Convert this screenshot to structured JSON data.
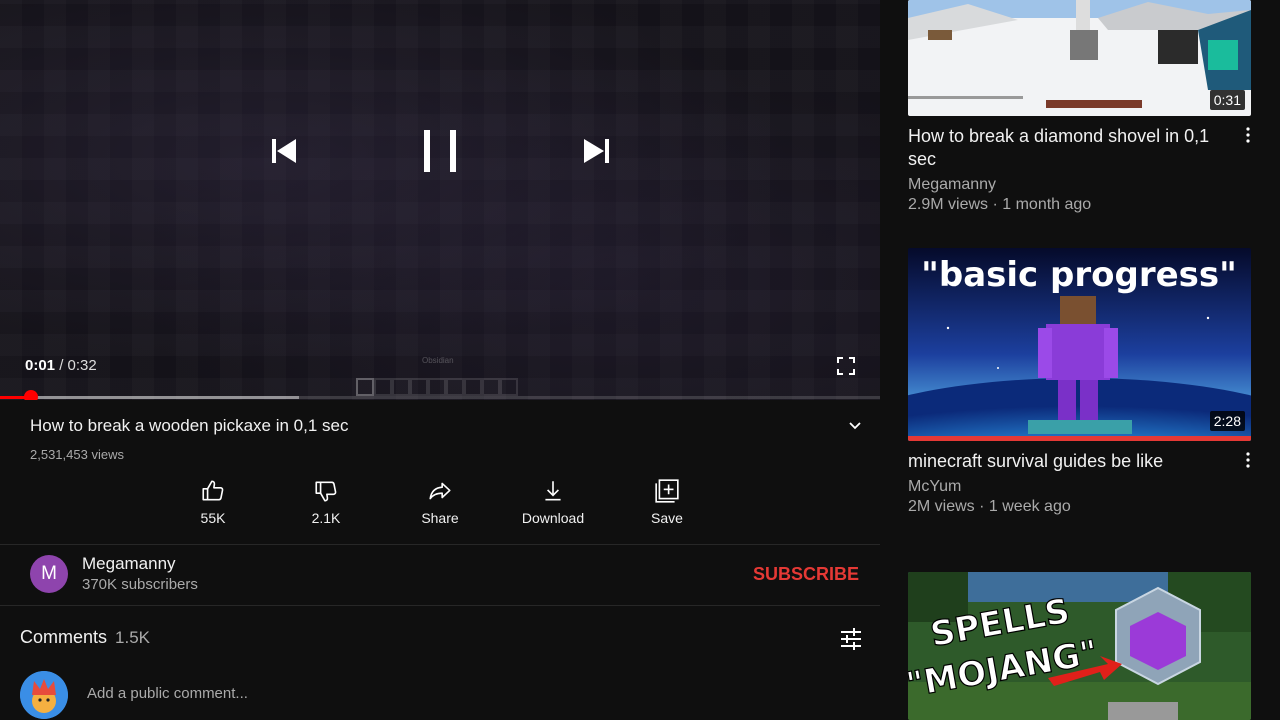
{
  "player": {
    "current_time": "0:01",
    "separator": "/",
    "duration": "0:32",
    "progress_fraction": 0.035,
    "buffered_fraction": 0.34,
    "watermark_text": "Obsidian",
    "icons": {
      "prev": "skip-previous-icon",
      "play": "pause-icon",
      "next": "skip-next-icon",
      "fullscreen": "fullscreen-icon"
    }
  },
  "video": {
    "title": "How to break a wooden pickaxe in 0,1 sec",
    "views": "2,531,453 views"
  },
  "actions": [
    {
      "label": "55K",
      "icon": "thumbs-up-icon"
    },
    {
      "label": "2.1K",
      "icon": "thumbs-down-icon"
    },
    {
      "label": "Share",
      "icon": "share-icon"
    },
    {
      "label": "Download",
      "icon": "download-icon"
    },
    {
      "label": "Save",
      "icon": "add-to-playlist-icon"
    }
  ],
  "channel": {
    "avatar_letter": "M",
    "name": "Megamanny",
    "subscribers": "370K subscribers",
    "subscribe_label": "SUBSCRIBE"
  },
  "comments": {
    "label": "Comments",
    "count": "1.5K",
    "placeholder": "Add a public comment..."
  },
  "recommendations": [
    {
      "title": "How to break a diamond shovel in 0,1 sec",
      "channel": "Megamanny",
      "meta": "2.9M views · 1 month ago",
      "duration": "0:31"
    },
    {
      "title": "minecraft survival guides be like",
      "channel": "McYum",
      "meta": "2M views · 1 week ago",
      "duration": "2:28",
      "thumb_text": "\"basic progress\""
    },
    {
      "thumb_text_line1": "SPELLS",
      "thumb_text_line2": "\"MOJANG\""
    }
  ],
  "colors": {
    "background": "#0f0f0f",
    "accent_red": "#ff0000",
    "subscribe_red": "#e53935",
    "channel_avatar": "#8e44ad"
  }
}
